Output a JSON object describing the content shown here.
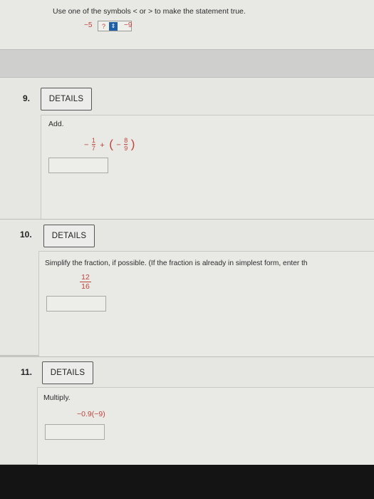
{
  "q8": {
    "instruction": "Use one of the symbols < or > to make the statement true.",
    "left": "−5",
    "select_value": "?",
    "right": "−9"
  },
  "q9": {
    "number": "9.",
    "details_label": "DETAILS",
    "prompt": "Add.",
    "expr": {
      "sign1": "−",
      "frac1_num": "1",
      "frac1_den": "7",
      "plus": "+",
      "open_paren": "(",
      "sign2": "−",
      "frac2_num": "8",
      "frac2_den": "9",
      "close_paren": ")"
    },
    "answer_value": ""
  },
  "q10": {
    "number": "10.",
    "details_label": "DETAILS",
    "prompt": "Simplify the fraction, if possible. (If the fraction is already in simplest form, enter th",
    "frac_num": "12",
    "frac_den": "16",
    "answer_value": ""
  },
  "q11": {
    "number": "11.",
    "details_label": "DETAILS",
    "prompt": "Multiply.",
    "expr": "−0.9(−9)",
    "answer_value": ""
  },
  "icons": {
    "select_arrow": "chevron-updown-icon"
  },
  "colors": {
    "accent": "#c2433a",
    "select_blue": "#1f5fa8"
  }
}
